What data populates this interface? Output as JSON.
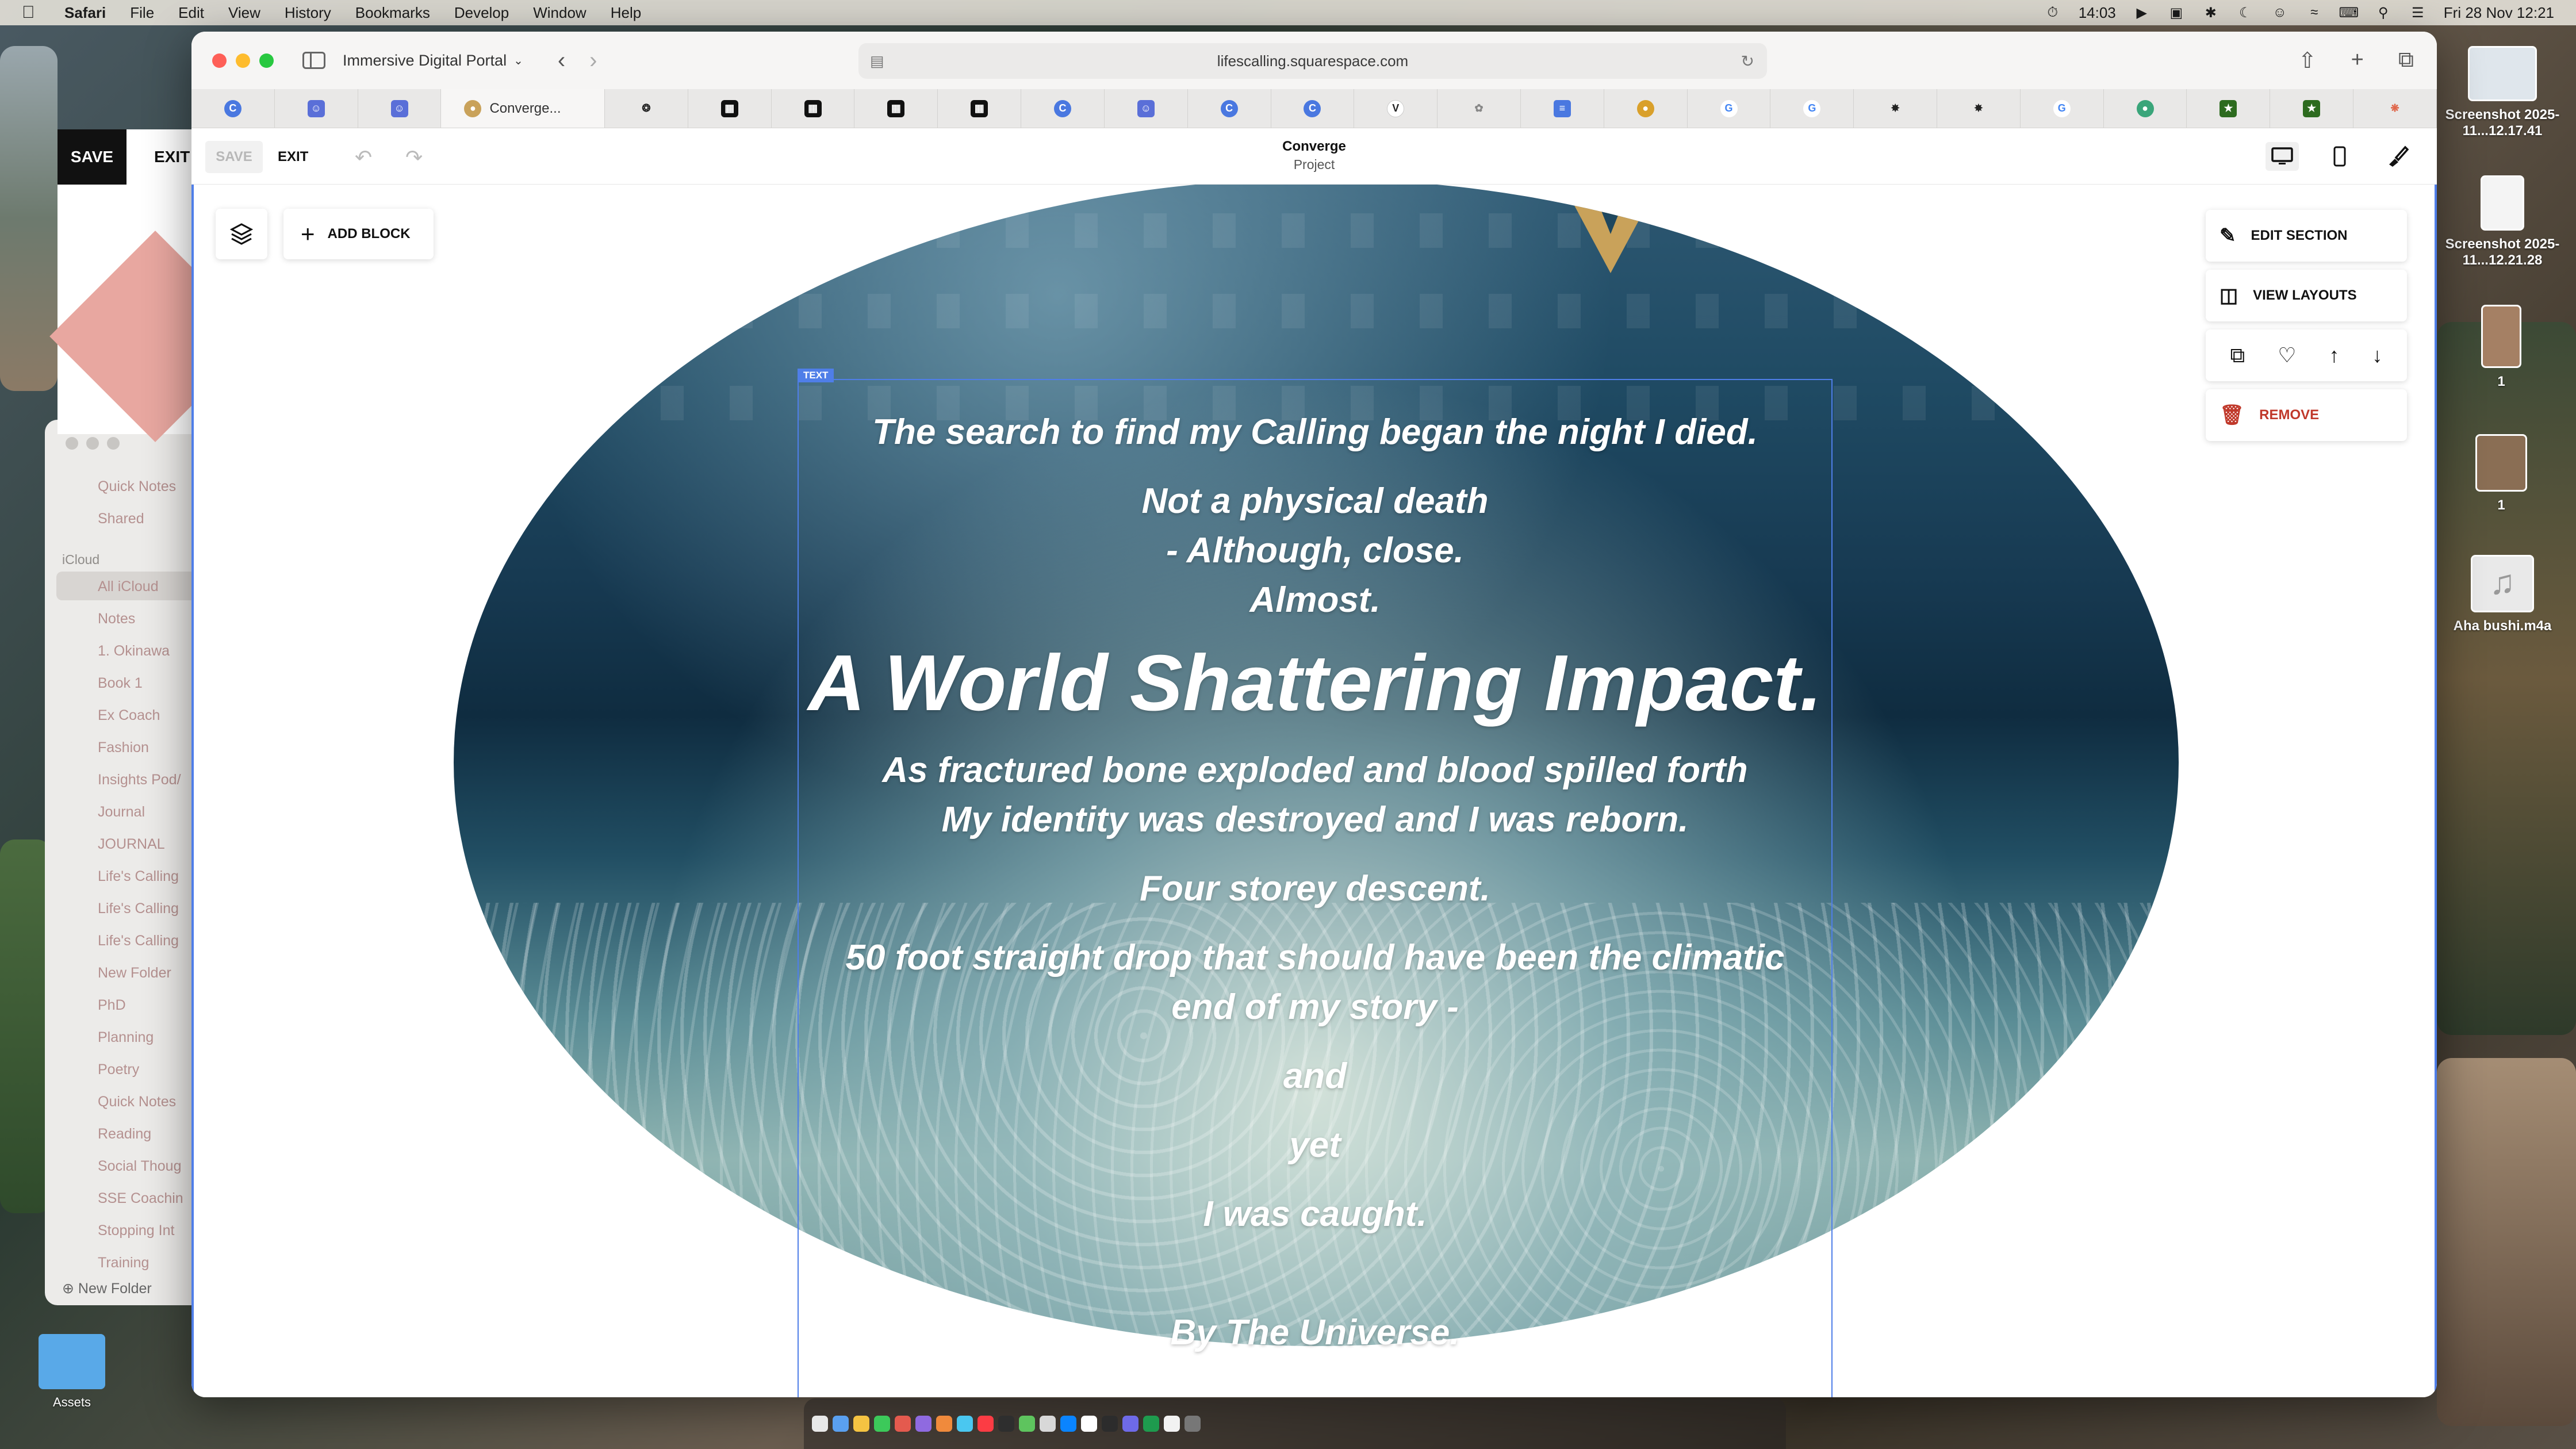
{
  "menubar": {
    "app": "Safari",
    "items": [
      "File",
      "Edit",
      "View",
      "History",
      "Bookmarks",
      "Develop",
      "Window",
      "Help"
    ],
    "timer": "14:03",
    "datetime": "Fri 28 Nov  12:21"
  },
  "desktop": {
    "icons": [
      {
        "label": "Screenshot 2025-11...12.17.41"
      },
      {
        "label": "Screenshot 2025-11...12.21.28"
      },
      {
        "label": "1"
      },
      {
        "label": "1"
      },
      {
        "label": "Aha bushi.m4a"
      }
    ],
    "assets_label": "Assets"
  },
  "other_window": {
    "save_label": "SAVE",
    "exit_label": "EXIT"
  },
  "notes_sidebar": {
    "top_items": [
      "Quick Notes",
      "Shared"
    ],
    "section": "iCloud",
    "folders": [
      "All iCloud",
      "Notes",
      "1. Okinawa",
      "Book 1",
      "Ex Coach",
      "Fashion",
      "Insights Pod/",
      "Journal",
      "JOURNAL",
      "Life's Calling",
      "Life's Calling",
      "Life's Calling",
      "New Folder",
      "PhD",
      "Planning",
      "Poetry",
      "Quick Notes",
      "Reading",
      "Social Thoug",
      "SSE Coachin",
      "Stopping Int",
      "Training"
    ],
    "new_folder": "New Folder"
  },
  "safari": {
    "tab_group": "Immersive Digital Portal",
    "url": "lifescalling.squarespace.com",
    "active_tab_label": "Converge...",
    "pinned_tabs": [
      {
        "icon": "circle-c-icon",
        "color": "#4a78e0"
      },
      {
        "icon": "chat-bubble-icon",
        "color": "#5a6fd8"
      },
      {
        "icon": "chat-bubble-icon",
        "color": "#5a6fd8"
      },
      {
        "icon": "spiral-icon",
        "color": "#222222"
      },
      {
        "icon": "squarespace-icon",
        "color": "#111111"
      },
      {
        "icon": "squarespace-icon",
        "color": "#111111"
      },
      {
        "icon": "squarespace-icon",
        "color": "#111111"
      },
      {
        "icon": "squarespace-icon",
        "color": "#111111"
      },
      {
        "icon": "circle-c-icon",
        "color": "#4a78e0"
      },
      {
        "icon": "chat-bubble-icon",
        "color": "#5a6fd8"
      },
      {
        "icon": "circle-c-icon",
        "color": "#4a78e0"
      },
      {
        "icon": "circle-c-icon",
        "color": "#4a78e0"
      },
      {
        "icon": "v-logo-icon",
        "color": "#333333"
      },
      {
        "icon": "feather-icon",
        "color": "#888888"
      },
      {
        "icon": "docs-icon",
        "color": "#4a78e0"
      },
      {
        "icon": "owl-icon",
        "color": "#d9a02b"
      },
      {
        "icon": "google-icon",
        "color": "#4285f4"
      },
      {
        "icon": "google-icon",
        "color": "#4285f4"
      },
      {
        "icon": "openai-icon",
        "color": "#222222"
      },
      {
        "icon": "openai-icon",
        "color": "#222222"
      },
      {
        "icon": "google-icon",
        "color": "#4285f4"
      },
      {
        "icon": "globe-icon",
        "color": "#3aa57a"
      },
      {
        "icon": "star-box-icon",
        "color": "#2d6b1f"
      },
      {
        "icon": "star-box-icon",
        "color": "#2d6b1f"
      },
      {
        "icon": "sunburst-icon",
        "color": "#e0664a"
      }
    ]
  },
  "editor": {
    "save_label": "SAVE",
    "exit_label": "EXIT",
    "site_title": "Converge",
    "site_subtitle": "Project",
    "add_block_label": "ADD BLOCK",
    "text_badge": "TEXT",
    "section_menu": {
      "edit_section": "EDIT SECTION",
      "view_layouts": "VIEW LAYOUTS",
      "remove": "REMOVE"
    }
  },
  "poem": {
    "line1": "The search to find my Calling began the night I died.",
    "line2": "Not a physical death",
    "line3": "- Although, close.",
    "line4": "Almost.",
    "headline": "A World Shattering Impact.",
    "line5": "As fractured bone exploded and blood spilled forth",
    "line6": "My identity was destroyed and I was reborn.",
    "line7": "Four storey descent.",
    "line8": "50 foot straight drop that should have been the climatic",
    "line9": "end of my story -",
    "line10": "and",
    "line11": "yet",
    "line12": "I was caught.",
    "line13": "By The Universe."
  },
  "colors": {
    "selection_blue": "#4f7ee8",
    "logo_gold": "#c9a25a",
    "remove_red": "#c0392b"
  }
}
